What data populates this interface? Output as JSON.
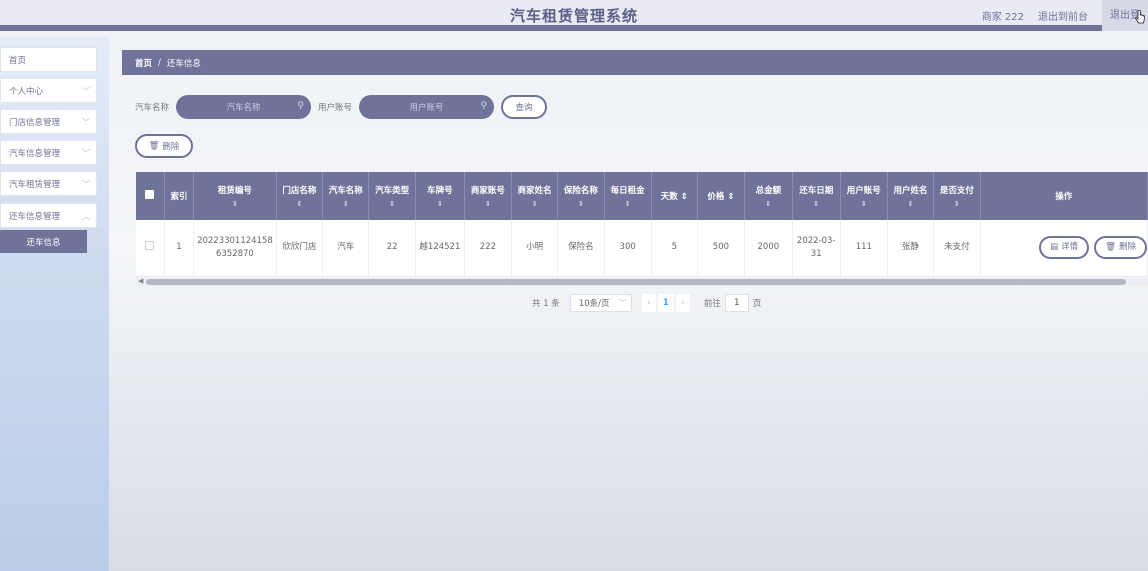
{
  "header": {
    "title": "汽车租赁管理系统",
    "user": "商家 222",
    "back_front": "退出到前台",
    "logout": "退出登"
  },
  "sidebar": {
    "items": [
      {
        "label": "首页"
      },
      {
        "label": "个人中心"
      },
      {
        "label": "门店信息管理"
      },
      {
        "label": "汽车信息管理"
      },
      {
        "label": "汽车租赁管理"
      },
      {
        "label": "还车信息管理"
      }
    ],
    "active_sub": "还车信息"
  },
  "breadcrumb": {
    "home": "首页",
    "sep": "/",
    "current": "还车信息"
  },
  "search": {
    "car_name_label": "汽车名称",
    "car_name_placeholder": "汽车名称",
    "user_account_label": "用户账号",
    "user_account_placeholder": "用户账号",
    "query_button": "查询"
  },
  "actions": {
    "delete_button": "删除"
  },
  "table": {
    "headers": [
      "索引",
      "租赁编号",
      "门店名称",
      "汽车名称",
      "汽车类型",
      "车牌号",
      "商家账号",
      "商家姓名",
      "保险名称",
      "每日租金",
      "天数",
      "价格",
      "总金额",
      "还车日期",
      "用户账号",
      "用户姓名",
      "是否支付",
      "操作"
    ],
    "rows": [
      {
        "index": "1",
        "rental_no": "20223301124158 6352870",
        "store": "欣欣门店",
        "car_name": "汽车",
        "car_type": "22",
        "plate": "越124521",
        "merchant_account": "222",
        "merchant_name": "小明",
        "insurance": "保险名",
        "daily_rent": "300",
        "days": "5",
        "price": "500",
        "total": "2000",
        "return_date": "2022-03-31",
        "user_account": "111",
        "user_name": "张静",
        "paid": "未支付",
        "detail_button": "详情",
        "delete_button": "删除"
      }
    ]
  },
  "pagination": {
    "total": "共 1 条",
    "page_size": "10条/页",
    "current_page": "1",
    "goto_label": "前往",
    "goto_value": "1",
    "page_suffix": "页"
  },
  "colors": {
    "primary": "#6f7299",
    "link": "#409eff"
  }
}
